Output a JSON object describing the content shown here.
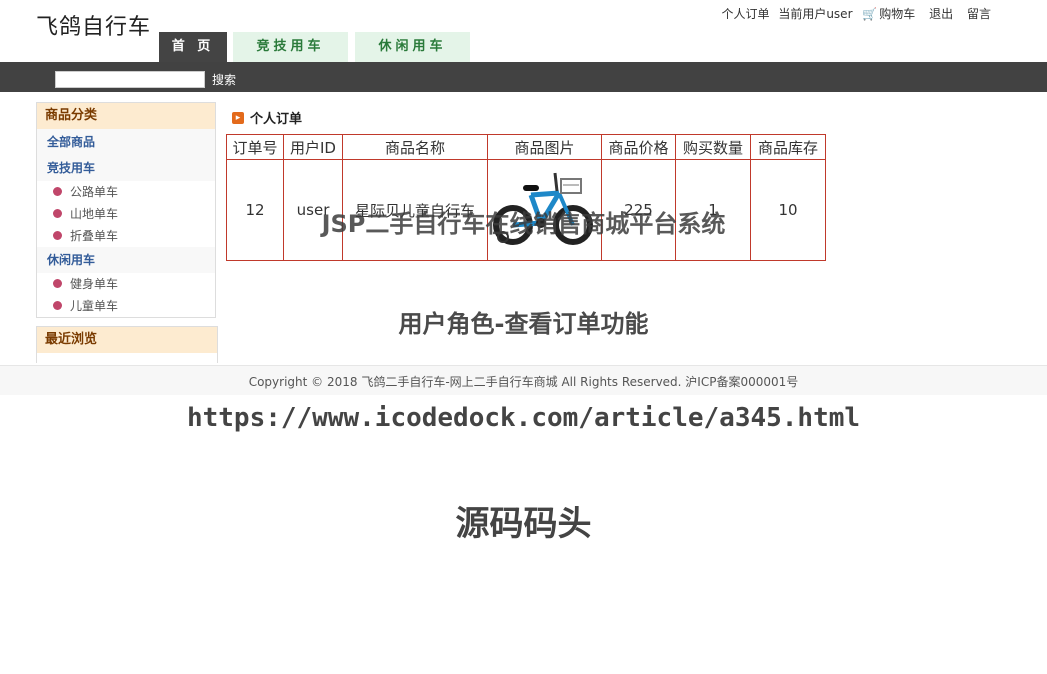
{
  "header": {
    "logo": "飞鸽自行车",
    "links": {
      "my_orders": "个人订单",
      "current_user": "当前用户user",
      "cart": "购物车",
      "logout": "退出",
      "message": "留言"
    }
  },
  "nav": {
    "tabs": [
      "首 页",
      "竞技用车",
      "休闲用车"
    ]
  },
  "search": {
    "value": "",
    "button": "搜索"
  },
  "sidebar": {
    "category_title": "商品分类",
    "all": "全部商品",
    "group1": {
      "title": "竞技用车",
      "items": [
        "公路单车",
        "山地单车",
        "折叠单车"
      ]
    },
    "group2": {
      "title": "休闲用车",
      "items": [
        "健身单车",
        "儿童单车"
      ]
    },
    "recent_title": "最近浏览"
  },
  "main": {
    "title": "个人订单",
    "columns": [
      "订单号",
      "用户ID",
      "商品名称",
      "商品图片",
      "商品价格",
      "购买数量",
      "商品库存"
    ],
    "row": {
      "order_id": "12",
      "user_id": "user",
      "product_name": "星际贝儿童自行车",
      "price": "225",
      "quantity": "1",
      "stock": "10"
    }
  },
  "footer": {
    "copyright": "Copyright © 2018 飞鸽二手自行车-网上二手自行车商城 All Rights Reserved. 沪ICP备案000001号"
  },
  "watermarks": {
    "line1": "JSP二手自行车在线销售商城平台系统",
    "line2": "用户角色-查看订单功能",
    "line3": "https://www.icodedock.com/article/a345.html",
    "line4": "源码码头"
  },
  "colors": {
    "nav_bar": "#424242",
    "tab_active": "#444444",
    "tab_inactive": "#e4f4e8",
    "table_border": "#c0392b",
    "panel_title_bg": "#fdebd0"
  }
}
